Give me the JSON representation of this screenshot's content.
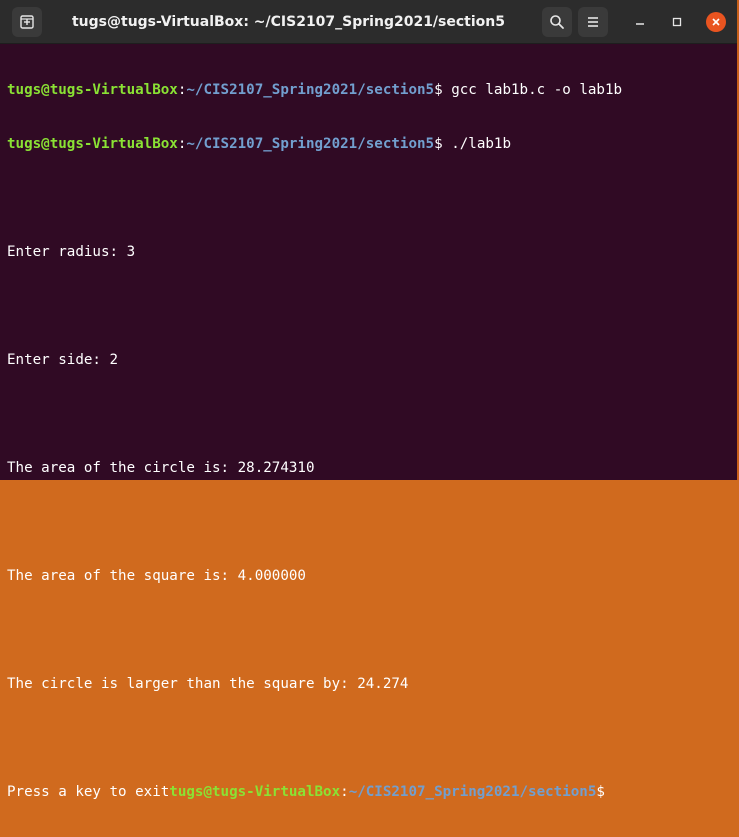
{
  "window": {
    "title": "tugs@tugs-VirtualBox: ~/CIS2107_Spring2021/section5"
  },
  "titlebar": {
    "new_tab_icon": "new-tab-icon",
    "search_icon": "search-icon",
    "menu_icon": "hamburger-menu-icon",
    "minimize_icon": "minimize-icon",
    "maximize_icon": "maximize-icon",
    "close_icon": "close-icon"
  },
  "colors": {
    "terminal_bg": "#300a24",
    "prompt_user": "#8ae234",
    "prompt_path": "#729fcf",
    "close_button": "#e95420"
  },
  "terminal": {
    "prompt_user": "tugs@tugs-VirtualBox",
    "prompt_sep": ":",
    "prompt_path": "~/CIS2107_Spring2021/section5",
    "prompt_dollar": "$",
    "cmd1": " gcc lab1b.c -o lab1b",
    "cmd2": " ./lab1b",
    "out_radius": "Enter radius: 3",
    "out_side": "Enter side: 2",
    "out_circle_area": "The area of the circle is: 28.274310",
    "out_square_area": "The area of the square is: 4.000000",
    "out_difference": "The circle is larger than the square by: 24.274",
    "out_press_key": "Press a key to exit"
  }
}
